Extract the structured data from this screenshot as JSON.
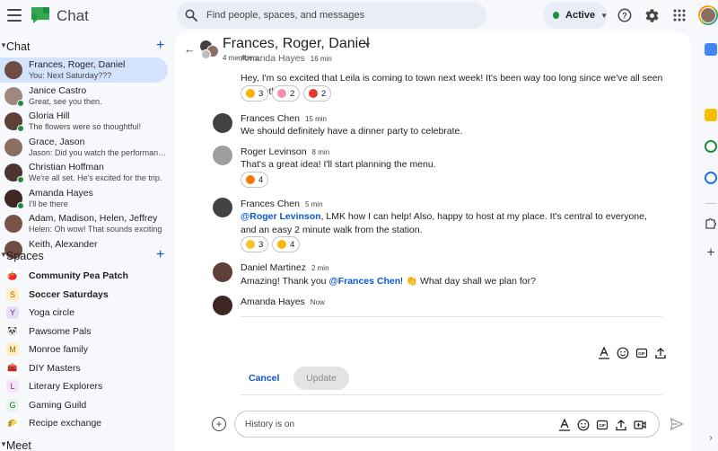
{
  "app": {
    "title": "Chat"
  },
  "search": {
    "placeholder": "Find people, spaces, and messages"
  },
  "status": {
    "label": "Active"
  },
  "sidebar": {
    "chat_header": "Chat",
    "spaces_header": "Spaces",
    "meet_header": "Meet",
    "chats": [
      {
        "name": "Frances, Roger, Daniel",
        "snippet": "You: Next Saturday???",
        "avatar_color": "#6d4c41",
        "selected": true
      },
      {
        "name": "Janice Castro",
        "snippet": "Great, see you then.",
        "avatar_color": "#a1887f"
      },
      {
        "name": "Gloria Hill",
        "snippet": "The flowers were so thoughtful!",
        "avatar_color": "#5d4037"
      },
      {
        "name": "Grace, Jason",
        "snippet": "Jason: Did you watch the performan…",
        "avatar_color": "#8d6e63"
      },
      {
        "name": "Christian Hoffman",
        "snippet": "We're all set.  He's excited for the trip.",
        "avatar_color": "#4e342e"
      },
      {
        "name": "Amanda Hayes",
        "snippet": "I'll be there",
        "avatar_color": "#3e2723"
      },
      {
        "name": "Adam, Madison, Helen, Jeffrey",
        "snippet": "Helen: Oh wow! That sounds exciting …",
        "avatar_color": "#795548"
      },
      {
        "name": "Keith, Alexander",
        "snippet": "",
        "avatar_color": "#6d4c41"
      }
    ],
    "spaces": [
      {
        "name": "Community Pea Patch",
        "icon": "🍅",
        "bg": "#ffffff",
        "fg": "#d93025",
        "bold": true
      },
      {
        "name": "Soccer Saturdays",
        "icon": "S",
        "bg": "#feefc3",
        "fg": "#b06000",
        "bold": true
      },
      {
        "name": "Yoga circle",
        "icon": "Y",
        "bg": "#e8def8",
        "fg": "#7b1fa2",
        "bold": false
      },
      {
        "name": "Pawsome Pals",
        "icon": "🐼",
        "bg": "#ffffff",
        "fg": "#1f1f1f",
        "bold": false
      },
      {
        "name": "Monroe family",
        "icon": "M",
        "bg": "#feefc3",
        "fg": "#b06000",
        "bold": false
      },
      {
        "name": "DIY Masters",
        "icon": "🧰",
        "bg": "#ffffff",
        "fg": "#d93025",
        "bold": false
      },
      {
        "name": "Literary Explorers",
        "icon": "L",
        "bg": "#f3e5f5",
        "fg": "#8e24aa",
        "bold": false
      },
      {
        "name": "Gaming Guild",
        "icon": "G",
        "bg": "#e6f4ea",
        "fg": "#137333",
        "bold": false
      },
      {
        "name": "Recipe exchange",
        "icon": "🌮",
        "bg": "#ffffff",
        "fg": "#e37400",
        "bold": false
      }
    ]
  },
  "conversation": {
    "title": "Frances, Roger, Daniel",
    "members": "4 members",
    "messages": [
      {
        "sender": "Amanda Hayes",
        "time": "16 min",
        "text": "Hey, I'm so excited that Leila is coming to town next week! It's been way too long since we've all seen each other.",
        "avatar_color": "#3e2723",
        "reactions": [
          {
            "emoji": "🥰",
            "color": "#f4b400",
            "count": "3"
          },
          {
            "emoji": "🦄",
            "color": "#f48fb1",
            "count": "2"
          },
          {
            "emoji": "❤️",
            "color": "#e53935",
            "count": "2"
          }
        ]
      },
      {
        "sender": "Frances Chen",
        "time": "15 min",
        "text": "We should definitely have a dinner party to celebrate.",
        "avatar_color": "#424242",
        "reactions": []
      },
      {
        "sender": "Roger Levinson",
        "time": "8 min",
        "text": "That's a great idea! I'll start planning the menu.",
        "avatar_color": "#9e9e9e",
        "reactions": [
          {
            "emoji": "🔥",
            "color": "#f57c00",
            "count": "4"
          }
        ]
      },
      {
        "sender": "Frances Chen",
        "time": "5 min",
        "mention": "@Roger Levinson",
        "text": ", LMK how I can help!  Also, happy to host at my place. It's central to everyone, and an easy 2 minute walk from the station.",
        "avatar_color": "#424242",
        "reactions": [
          {
            "emoji": "🌟",
            "color": "#fbc02d",
            "count": "3"
          },
          {
            "emoji": "🥳",
            "color": "#ffb300",
            "count": "4"
          }
        ]
      },
      {
        "sender": "Daniel Martinez",
        "time": "2 min",
        "text_before": "Amazing! Thank you ",
        "mention": "@Frances Chen",
        "text_after": "! 👏 What day shall we plan for?",
        "avatar_color": "#5d4037",
        "reactions": []
      },
      {
        "sender": "Amanda Hayes",
        "time": "Now",
        "avatar_color": "#3e2723"
      }
    ],
    "edit": {
      "cancel_label": "Cancel",
      "update_label": "Update"
    },
    "compose": {
      "placeholder": "History is on"
    }
  }
}
